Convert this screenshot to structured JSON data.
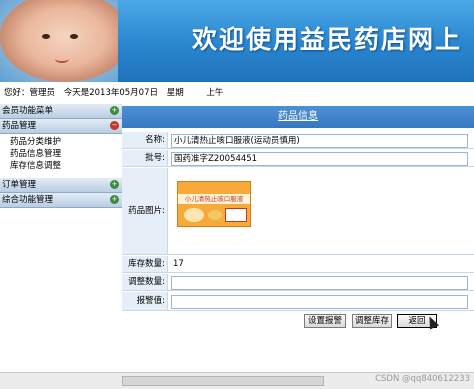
{
  "banner": {
    "title": "欢迎使用益民药店网上"
  },
  "infobar": {
    "user": "您好：管理员",
    "date": "今天是2013年05月07日",
    "weekday_label": "星期",
    "period": "上午"
  },
  "sidebar": {
    "sections": [
      {
        "label": "会员功能菜单",
        "toggle": "+",
        "expanded": false
      },
      {
        "label": "药品管理",
        "toggle": "−",
        "expanded": true
      },
      {
        "label": "订单管理",
        "toggle": "+",
        "expanded": false
      },
      {
        "label": "综合功能管理",
        "toggle": "+",
        "expanded": false
      }
    ],
    "drug_items": [
      "药品分类维护",
      "药品信息管理",
      "库存信息调整"
    ]
  },
  "main": {
    "title": "药品信息",
    "fields": {
      "name_label": "名称:",
      "name_value": "小儿清热止咳口服液(运动员慎用)",
      "approval_label": "批号:",
      "approval_value": "国药准字Z20054451",
      "image_label": "药品图片:",
      "image_package_text": "小儿清热止咳口服液",
      "stock_label": "库存数量:",
      "stock_value": "17",
      "adjust_label": "调整数量:",
      "adjust_value": "",
      "alert_label": "报警值:",
      "alert_value": ""
    },
    "buttons": {
      "set_alert": "设置报警",
      "adjust_stock": "调整库存",
      "back": "返回"
    }
  },
  "watermark": "CSDN @qq840612233",
  "colors": {
    "banner": "#2a86cf",
    "title_bar": "#3577c2",
    "label_bg": "#e6eef8"
  }
}
